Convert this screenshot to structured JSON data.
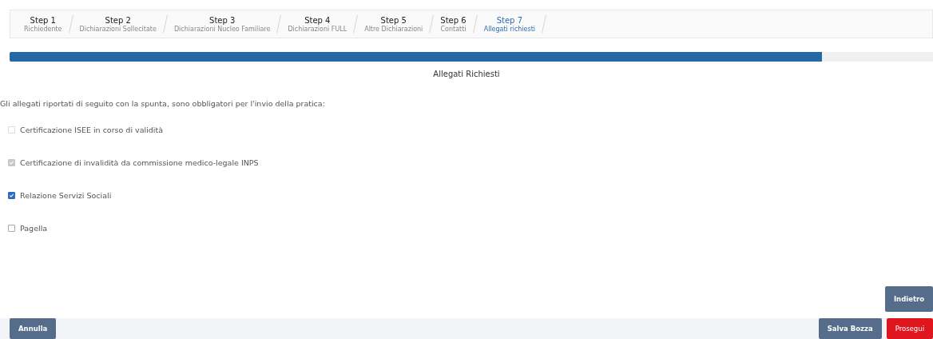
{
  "steps": [
    {
      "title": "Step 1",
      "subtitle": "Richiedente",
      "selected": false
    },
    {
      "title": "Step 2",
      "subtitle": "Dichiarazioni Sollecitate",
      "selected": false
    },
    {
      "title": "Step 3",
      "subtitle": "Dichiarazioni Nucleo Familiare",
      "selected": false
    },
    {
      "title": "Step 4",
      "subtitle": "Dichiarazioni FULL",
      "selected": false
    },
    {
      "title": "Step 5",
      "subtitle": "Altre Dichiarazioni",
      "selected": false
    },
    {
      "title": "Step 6",
      "subtitle": "Contatti",
      "selected": false
    },
    {
      "title": "Step 7",
      "subtitle": "Allegati richiesti",
      "selected": true
    }
  ],
  "progress": {
    "level": 0.88
  },
  "heading": "Allegati Richiesti",
  "intro": "Gli allegati riportati di seguito con la spunta, sono obbligatori per l'invio della pratica:",
  "attachments": [
    {
      "label": "Certificazione ISEE in corso di validità",
      "checked": false,
      "disabled": true
    },
    {
      "label": "Certificazione di invalidità da commissione medico-legale INPS",
      "checked": true,
      "disabled": true
    },
    {
      "label": "Relazione Servizi Sociali",
      "checked": true,
      "disabled": false
    },
    {
      "label": "Pagella",
      "checked": false,
      "disabled": false
    }
  ],
  "back_button": "Indietro",
  "footer": {
    "cancel": "Annulla",
    "save_draft": "Salva Bozza",
    "next": "Prosegui"
  }
}
